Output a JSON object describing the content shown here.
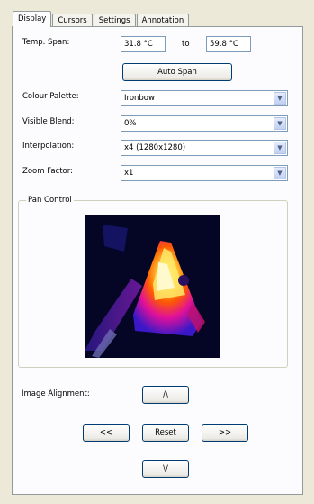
{
  "tabs": [
    {
      "label": "Display",
      "active": true
    },
    {
      "label": "Cursors",
      "active": false
    },
    {
      "label": "Settings",
      "active": false
    },
    {
      "label": "Annotation",
      "active": false
    }
  ],
  "temp_span": {
    "label": "Temp. Span:",
    "min_value": "31.8 °C",
    "to_label": "to",
    "max_value": "59.8 °C"
  },
  "auto_span_label": "Auto Span",
  "colour_palette": {
    "label": "Colour Palette:",
    "value": "Ironbow"
  },
  "visible_blend": {
    "label": "Visible Blend:",
    "value": "0%"
  },
  "interpolation": {
    "label": "Interpolation:",
    "value": "x4 (1280x1280)"
  },
  "zoom_factor": {
    "label": "Zoom Factor:",
    "value": "x1"
  },
  "pan_control": {
    "title": "Pan Control"
  },
  "image_alignment": {
    "label": "Image Alignment:",
    "up_label": "/\\",
    "left_label": "<<",
    "reset_label": "Reset",
    "right_label": ">>",
    "down_label": "\\/"
  },
  "colors": {
    "background": "#ece9d8",
    "panel": "#fcfcfe",
    "thermal_bg": "#050525",
    "thermal_hot": "#fff7a0",
    "thermal_mid": "#ff5a00",
    "thermal_warm": "#d0109a",
    "thermal_cool": "#3a18c8"
  }
}
